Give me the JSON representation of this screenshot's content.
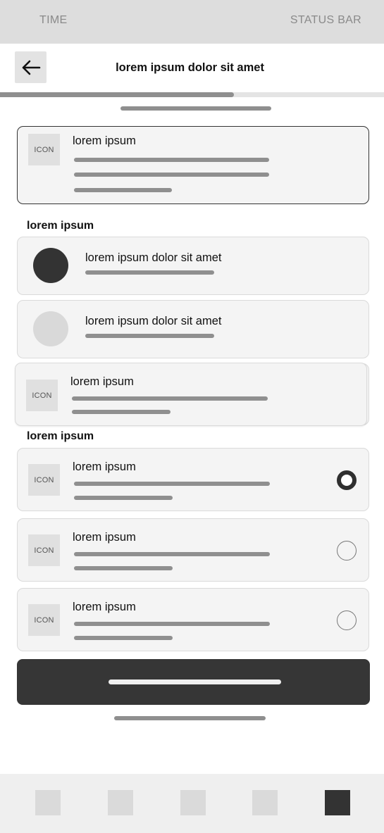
{
  "status_bar": {
    "time": "TIME",
    "status": "STATUS BAR"
  },
  "header": {
    "title": "lorem ipsum dolor sit amet",
    "back_icon": "arrow-left-icon"
  },
  "progress": {
    "value_fraction": 0.61
  },
  "top_card": {
    "icon_label": "ICON",
    "title": "lorem ipsum"
  },
  "section1": {
    "label": "lorem ipsum",
    "items": [
      {
        "title": "lorem ipsum dolor sit amet",
        "avatar_color": "#333333"
      },
      {
        "title": "lorem ipsum dolor sit amet",
        "avatar_color": "#d9d9d9"
      }
    ]
  },
  "dragged_card": {
    "icon_label": "ICON",
    "title": "lorem ipsum"
  },
  "section2": {
    "label": "lorem ipsum",
    "options": [
      {
        "icon_label": "ICON",
        "title": "lorem ipsum",
        "selected": true
      },
      {
        "icon_label": "ICON",
        "title": "lorem ipsum",
        "selected": false
      },
      {
        "icon_label": "ICON",
        "title": "lorem ipsum",
        "selected": false
      }
    ]
  },
  "colors": {
    "primary": "#363636",
    "placeholder_line": "#8f8f8f",
    "card_bg": "#f4f4f4",
    "status_bar_bg": "#dddddd"
  },
  "bottom_nav": {
    "items": 5,
    "active_index": 4
  }
}
